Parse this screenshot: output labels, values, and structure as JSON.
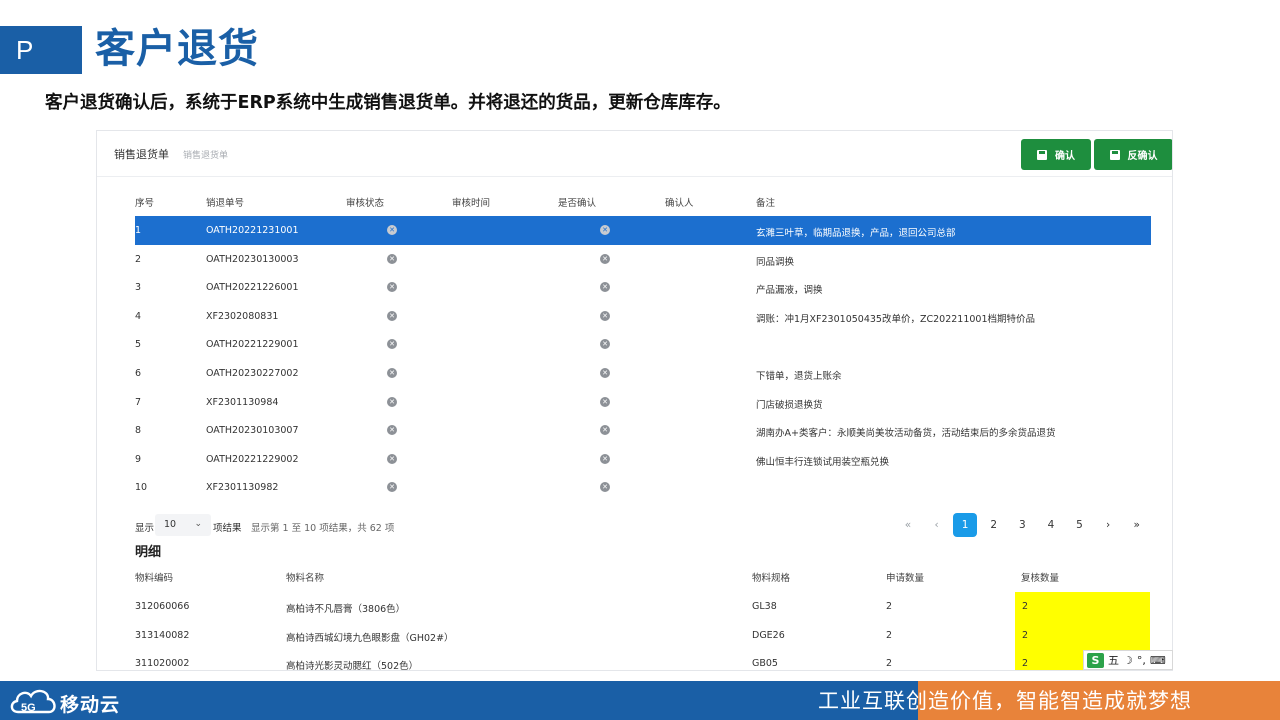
{
  "slide": {
    "badge": "P",
    "title": "客户退货",
    "subtitle": "客户退货确认后，系统于ERP系统中生成销售退货单。并将退还的货品，更新仓库库存。"
  },
  "app": {
    "breadcrumb_main": "销售退货单",
    "breadcrumb_sub": "销售退货单",
    "confirm_label": "确认",
    "unconfirm_label": "反确认",
    "accent_color": "#1e8e3e",
    "selected_row_color": "#1c6fcf"
  },
  "table": {
    "headers": [
      "序号",
      "销退单号",
      "审核状态",
      "审核时间",
      "是否确认",
      "确认人",
      "备注"
    ],
    "rows": [
      {
        "no": "1",
        "order": "OATH20221231001",
        "remark": "玄濉三叶草，临期品退换，产品，退回公司总部",
        "audit_icon": "x-circle-icon",
        "confirm_icon": "x-circle-icon"
      },
      {
        "no": "2",
        "order": "OATH20230130003",
        "remark": "同品调换",
        "audit_icon": "x-circle-icon",
        "confirm_icon": "x-circle-icon"
      },
      {
        "no": "3",
        "order": "OATH20221226001",
        "remark": "产品漏液，调换",
        "audit_icon": "x-circle-icon",
        "confirm_icon": "x-circle-icon"
      },
      {
        "no": "4",
        "order": "XF2302080831",
        "remark": "调账：冲1月XF2301050435改单价，ZC202211001档期特价品",
        "audit_icon": "x-circle-icon",
        "confirm_icon": "x-circle-icon"
      },
      {
        "no": "5",
        "order": "OATH20221229001",
        "remark": "",
        "audit_icon": "x-circle-icon",
        "confirm_icon": "x-circle-icon"
      },
      {
        "no": "6",
        "order": "OATH20230227002",
        "remark": "下错单，退货上账余",
        "audit_icon": "x-circle-icon",
        "confirm_icon": "x-circle-icon"
      },
      {
        "no": "7",
        "order": "XF2301130984",
        "remark": "门店破损退换货",
        "audit_icon": "x-circle-icon",
        "confirm_icon": "x-circle-icon"
      },
      {
        "no": "8",
        "order": "OATH20230103007",
        "remark": "湖南办A+类客户：永顺美尚美妆活动备货，活动结束后的多余货品退货",
        "audit_icon": "x-circle-icon",
        "confirm_icon": "x-circle-icon"
      },
      {
        "no": "9",
        "order": "OATH20221229002",
        "remark": "佛山恒丰行连锁试用装空瓶兑换",
        "audit_icon": "x-circle-icon",
        "confirm_icon": "x-circle-icon"
      },
      {
        "no": "10",
        "order": "XF2301130982",
        "remark": "",
        "audit_icon": "x-circle-icon",
        "confirm_icon": "x-circle-icon"
      }
    ],
    "selected_row": "1"
  },
  "pagination": {
    "show_label": "显示",
    "page_size": "10",
    "items_label": "项结果",
    "info": "显示第 1 至 10 项结果，共 62 项",
    "first": "«",
    "prev": "‹",
    "pages": [
      "1",
      "2",
      "3",
      "4",
      "5"
    ],
    "current": "1",
    "next": "›",
    "last": "»"
  },
  "detail": {
    "title": "明细",
    "headers": [
      "物料编码",
      "物料名称",
      "物料规格",
      "申请数量",
      "复核数量"
    ],
    "rows": [
      {
        "code": "312060066",
        "name": "高柏诗不凡唇膏（3806色）",
        "spec": "GL38",
        "apply_qty": "2",
        "review_qty": "2"
      },
      {
        "code": "313140082",
        "name": "高柏诗西城幻境九色眼影盘（GH02#）",
        "spec": "DGE26",
        "apply_qty": "2",
        "review_qty": "2"
      },
      {
        "code": "311020002",
        "name": "高柏诗光影灵动腮红（502色）",
        "spec": "GB05",
        "apply_qty": "2",
        "review_qty": "2"
      }
    ],
    "highlight_color": "#ffff00"
  },
  "ime": {
    "logo": "S",
    "mode": "五",
    "moon": "☽",
    "punct": "°,",
    "keyboard": "⌨"
  },
  "footer": {
    "logo_text": "移动云",
    "logo_digit": "5G",
    "slogan": "工业互联创造价值，智能智造成就梦想",
    "brand_blue": "#1a5fa6",
    "brand_orange": "#e8833a"
  }
}
